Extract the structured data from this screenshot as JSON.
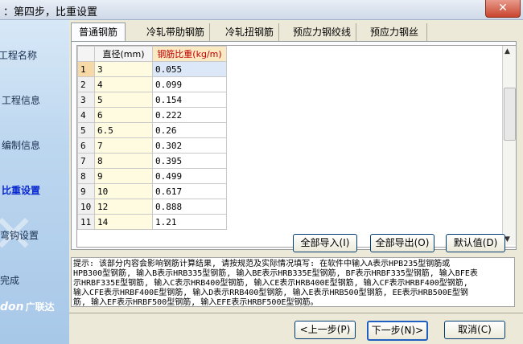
{
  "window": {
    "title": "：第四步，比重设置",
    "close": "✕"
  },
  "sidebar": {
    "items": [
      {
        "label": "工程名称"
      },
      {
        "label": "工程信息"
      },
      {
        "label": "编制信息"
      },
      {
        "label": "比重设置"
      },
      {
        "label": "弯钩设置"
      },
      {
        "label": "完成"
      }
    ],
    "logo_text": "don",
    "logo_cn": "广联达"
  },
  "tabs": [
    "普通钢筋",
    "冷轧带肋钢筋",
    "冷轧扭钢筋",
    "预应力钢绞线",
    "预应力钢丝"
  ],
  "table": {
    "headers": [
      "直径(mm)",
      "钢筋比重(kg/m)"
    ],
    "rows": [
      [
        "1",
        "3",
        "0.055"
      ],
      [
        "2",
        "4",
        "0.099"
      ],
      [
        "3",
        "5",
        "0.154"
      ],
      [
        "4",
        "6",
        "0.222"
      ],
      [
        "5",
        "6.5",
        "0.26"
      ],
      [
        "6",
        "7",
        "0.302"
      ],
      [
        "7",
        "8",
        "0.395"
      ],
      [
        "8",
        "9",
        "0.499"
      ],
      [
        "9",
        "10",
        "0.617"
      ],
      [
        "10",
        "12",
        "0.888"
      ],
      [
        "11",
        "14",
        "1.21"
      ]
    ]
  },
  "buttons": {
    "import_all": "全部导入(I)",
    "export_all": "全部导出(O)",
    "default": "默认值(D)",
    "prev": "<上一步(P)",
    "next": "下一步(N)>",
    "cancel": "取消(C)"
  },
  "hint": [
    "提示: 该部分内容会影响钢筋计算结果, 请按规范及实际情况填写: 在软件中输入A表示HPB235型钢筋或",
    "HPB300型钢筋, 输入B表示HRB335型钢筋, 输入BE表示HRB335E型钢筋, BF表示HRBF335型钢筋, 输入BFE表",
    "示HRBF335E型钢筋, 输入C表示HRB400型钢筋, 输入CE表示HRB400E型钢筋, 输入CF表示HRBF400型钢筋,",
    "输入CFE表示HRBF400E型钢筋, 输入D表示RRB400型钢筋, 输入E表示HRB500型钢筋, EE表示HRB500E型钢",
    "筋, 输入EF表示HRBF500型钢筋, 输入EFE表示HRBF500E型钢筋。"
  ]
}
